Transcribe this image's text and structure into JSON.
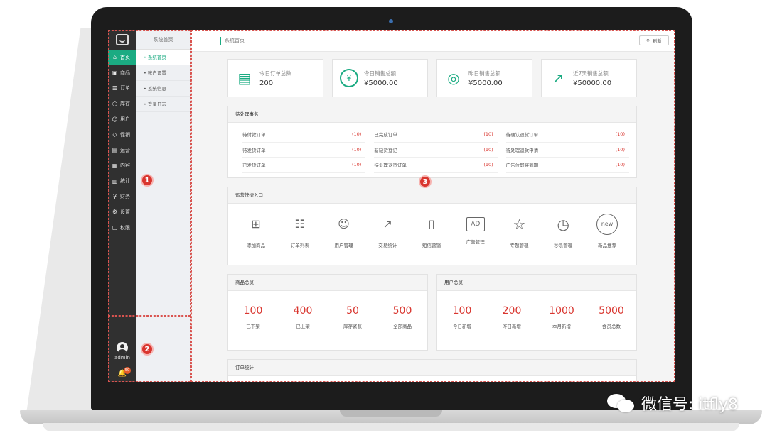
{
  "sidebar": {
    "items": [
      {
        "label": "首页",
        "icon": "home-icon",
        "glyph": "⌂"
      },
      {
        "label": "商品",
        "icon": "goods-icon",
        "glyph": "▣"
      },
      {
        "label": "订单",
        "icon": "order-icon",
        "glyph": "☰"
      },
      {
        "label": "库存",
        "icon": "stock-icon",
        "glyph": "⬡"
      },
      {
        "label": "用户",
        "icon": "user-icon",
        "glyph": "☺"
      },
      {
        "label": "促销",
        "icon": "tag-icon",
        "glyph": "◇"
      },
      {
        "label": "运营",
        "icon": "operation-icon",
        "glyph": "▤"
      },
      {
        "label": "内容",
        "icon": "content-icon",
        "glyph": "▦"
      },
      {
        "label": "统计",
        "icon": "chart-icon",
        "glyph": "▥"
      },
      {
        "label": "财务",
        "icon": "finance-icon",
        "glyph": "¥"
      },
      {
        "label": "设置",
        "icon": "gear-icon",
        "glyph": "⚙"
      },
      {
        "label": "权限",
        "icon": "lock-icon",
        "glyph": "▢"
      }
    ],
    "user": "admin",
    "notification_count": "50"
  },
  "subnav": {
    "title": "系统首页",
    "items": [
      "• 系统首页",
      "• 账户设置",
      "• 系统信息",
      "• 登录日志"
    ]
  },
  "topbar": {
    "breadcrumb": "系统首页",
    "refresh_label": "刷新"
  },
  "cards": [
    {
      "label": "今日订单总数",
      "value": "200",
      "icon": "clipboard-icon"
    },
    {
      "label": "今日销售总额",
      "value": "¥5000.00",
      "icon": "yen-icon"
    },
    {
      "label": "昨日销售总额",
      "value": "¥5000.00",
      "icon": "coins-icon"
    },
    {
      "label": "近7天销售总额",
      "value": "¥50000.00",
      "icon": "trend-icon"
    }
  ],
  "pending": {
    "title": "待处理事务",
    "items": [
      {
        "label": "待付款订单",
        "count": "(10)"
      },
      {
        "label": "已完成订单",
        "count": "(10)"
      },
      {
        "label": "待确认退货订单",
        "count": "(10)"
      },
      {
        "label": "待发货订单",
        "count": "(10)"
      },
      {
        "label": "新缺货登记",
        "count": "(10)"
      },
      {
        "label": "待处理退款申请",
        "count": "(10)"
      },
      {
        "label": "已发货订单",
        "count": "(10)"
      },
      {
        "label": "待处理退货订单",
        "count": "(10)"
      },
      {
        "label": "广告位即将到期",
        "count": "(10)"
      }
    ]
  },
  "quick": {
    "title": "运营快捷入口",
    "items": [
      {
        "label": "添加商品",
        "icon": "plus-box-icon",
        "glyph": "⊞"
      },
      {
        "label": "订单列表",
        "icon": "list-icon",
        "glyph": "☷"
      },
      {
        "label": "用户管理",
        "icon": "user-settings-icon",
        "glyph": "☺"
      },
      {
        "label": "交易统计",
        "icon": "trend-chart-icon",
        "glyph": "↗"
      },
      {
        "label": "短信营销",
        "icon": "sms-icon",
        "glyph": "▯"
      },
      {
        "label": "广告管理",
        "icon": "ad-icon",
        "glyph": "AD"
      },
      {
        "label": "专题管理",
        "icon": "star-icon",
        "glyph": "☆"
      },
      {
        "label": "秒杀管理",
        "icon": "alarm-clock-icon",
        "glyph": "◷"
      },
      {
        "label": "新品推荐",
        "icon": "new-icon",
        "glyph": "new"
      }
    ]
  },
  "product_overview": {
    "title": "商品总览",
    "stats": [
      {
        "value": "100",
        "label": "已下架"
      },
      {
        "value": "400",
        "label": "已上架"
      },
      {
        "value": "50",
        "label": "库存紧张"
      },
      {
        "value": "500",
        "label": "全部商品"
      }
    ]
  },
  "user_overview": {
    "title": "用户总览",
    "stats": [
      {
        "value": "100",
        "label": "今日新增"
      },
      {
        "value": "200",
        "label": "昨日新增"
      },
      {
        "value": "1000",
        "label": "本月新增"
      },
      {
        "value": "5000",
        "label": "会员总数"
      }
    ]
  },
  "order_stats": {
    "title": "订单统计"
  },
  "markers": [
    "1",
    "2",
    "3"
  ],
  "watermark": "微信号: itfly8",
  "colors": {
    "accent": "#1bab82",
    "alert": "#d9362f",
    "sidebar": "#303030"
  }
}
